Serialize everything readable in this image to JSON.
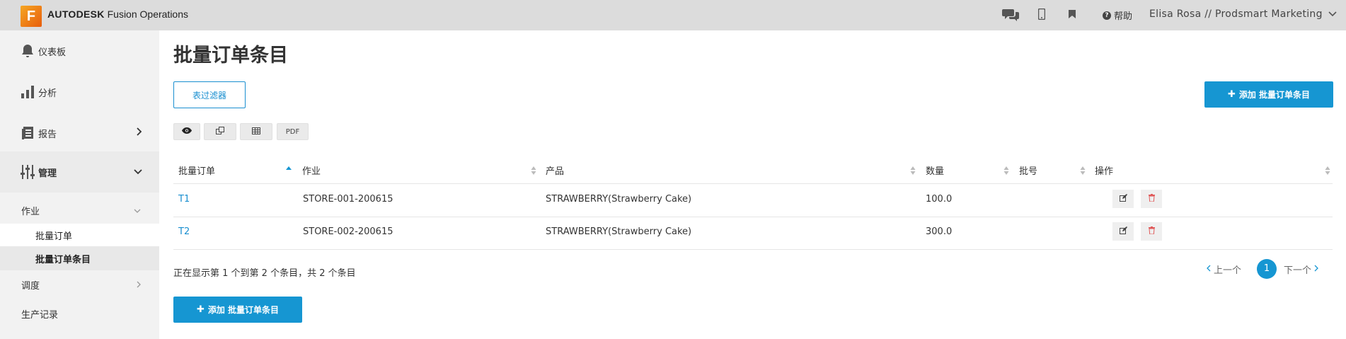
{
  "header": {
    "logo_letter": "F",
    "brand_bold": "AUTODESK",
    "brand_rest": " Fusion Operations",
    "help_label": "帮助",
    "user_label": "Elisa Rosa // Prodsmart Marketing",
    "icons": [
      "chat-icon",
      "mobile-icon",
      "bookmark-icon",
      "help-icon",
      "chevron-down-icon"
    ]
  },
  "sidebar": {
    "items": [
      {
        "label": "仪表板",
        "icon": "bell-icon"
      },
      {
        "label": "分析",
        "icon": "bar-chart-icon"
      },
      {
        "label": "报告",
        "icon": "report-icon"
      },
      {
        "label": "管理",
        "icon": "sliders-icon"
      }
    ],
    "sub": [
      {
        "label": "作业"
      },
      {
        "label": "调度"
      },
      {
        "label": "生产记录"
      }
    ],
    "subsub": [
      {
        "label": "批量订单"
      },
      {
        "label": "批量订单条目"
      }
    ]
  },
  "main": {
    "title": "批量订单条目",
    "filter_label": "表过滤器",
    "add_label": "添加 批量订单条目",
    "pdf_label": "PDF",
    "columns": [
      "批量订单",
      "作业",
      "产品",
      "数量",
      "批号",
      "操作"
    ],
    "rows": [
      {
        "order": "T1",
        "job": "STORE-001-200615",
        "product": "STRAWBERRY(Strawberry Cake)",
        "qty": "100.0",
        "batch": ""
      },
      {
        "order": "T2",
        "job": "STORE-002-200615",
        "product": "STRAWBERRY(Strawberry Cake)",
        "qty": "300.0",
        "batch": ""
      }
    ],
    "info": "正在显示第 1 个到第 2 个条目，共 2 个条目",
    "prev_label": "上一个",
    "next_label": "下一个",
    "current_page": "1"
  },
  "colors": {
    "accent": "#1696d2",
    "topbar": "#dcdcdc",
    "sidebar": "#f2f2f2",
    "delete": "#e05a5a"
  }
}
